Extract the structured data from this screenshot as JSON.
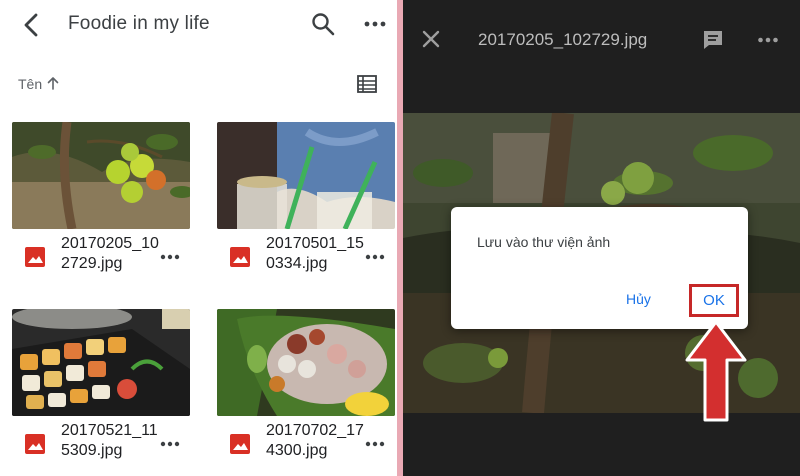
{
  "left": {
    "header": {
      "title": "Foodie in my life"
    },
    "sort": {
      "label": "Tên"
    },
    "files": [
      {
        "name": "20170205_102729.jpg"
      },
      {
        "name": "20170501_150334.jpg"
      },
      {
        "name": "20170521_115309.jpg"
      },
      {
        "name": "20170702_174300.jpg"
      }
    ]
  },
  "right": {
    "header": {
      "title": "20170205_102729.jpg"
    },
    "dialog": {
      "message": "Lưu vào thư viện ảnh",
      "cancel_label": "Hủy",
      "ok_label": "OK"
    }
  },
  "colors": {
    "accent": "#1a73e8",
    "file_icon": "#d93025",
    "highlight": "#c62828",
    "divider": "#e9a9b4"
  },
  "icons": [
    "back-arrow-icon",
    "search-icon",
    "more-vert-icon",
    "sort-up-icon",
    "list-view-icon",
    "image-file-icon",
    "close-icon",
    "comment-icon",
    "red-arrow-icon"
  ]
}
